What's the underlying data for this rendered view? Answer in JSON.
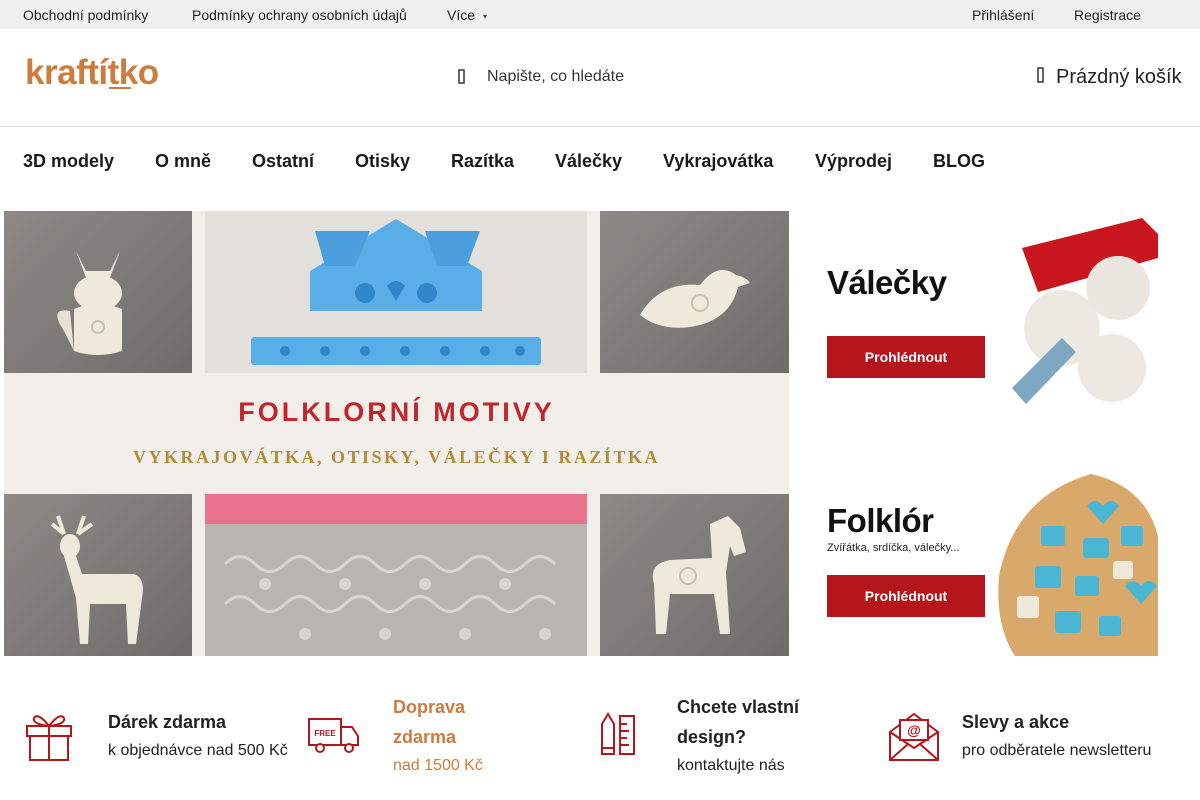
{
  "topbar": {
    "links": [
      "Obchodní podmínky",
      "Podmínky ochrany osobních údajů",
      "Více"
    ],
    "more_caret": "▾",
    "account": [
      "Přihlášení",
      "Registrace"
    ]
  },
  "header": {
    "logo_text": "kraftítko",
    "search_placeholder": "Napište, co hledáte",
    "cart_label": "Prázdný košík"
  },
  "nav": {
    "items": [
      "3D modely",
      "O mně",
      "Ostatní",
      "Otisky",
      "Razítka",
      "Válečky",
      "Vykrajovátka",
      "Výprodej",
      "BLOG"
    ]
  },
  "hero": {
    "title": "FOLKLORNÍ MOTIVY",
    "subtitle": "VYKRAJOVÁTKA, OTISKY, VÁLEČKY I RAZÍTKA"
  },
  "banners": [
    {
      "title": "Válečky",
      "subtitle": "",
      "button": "Prohlédnout"
    },
    {
      "title": "Folklór",
      "subtitle": "Zvířátka, srdíčka, válečky...",
      "button": "Prohlédnout"
    }
  ],
  "features": [
    {
      "icon": "gift-icon",
      "title": "Dárek zdarma",
      "text": "k objednávce nad 500 Kč"
    },
    {
      "icon": "free-delivery-truck-icon",
      "title_lines": [
        "Doprava",
        "zdarma"
      ],
      "text": "nad 1500 Kč"
    },
    {
      "icon": "design-pencil-ruler-icon",
      "title_lines": [
        "Chcete vlastní",
        "design?"
      ],
      "text": "kontaktujte nás"
    },
    {
      "icon": "newsletter-envelope-icon",
      "title": "Slevy a akce",
      "text": "pro odběratele newsletteru"
    }
  ],
  "colors": {
    "brand_orange": "#cd7c3f",
    "button_red": "#b4161b",
    "hero_title_red": "#c0272d",
    "hero_subtitle_gold": "#b58a37",
    "topbar_bg": "#efefef",
    "cutter_blue": "#5aaee8"
  }
}
